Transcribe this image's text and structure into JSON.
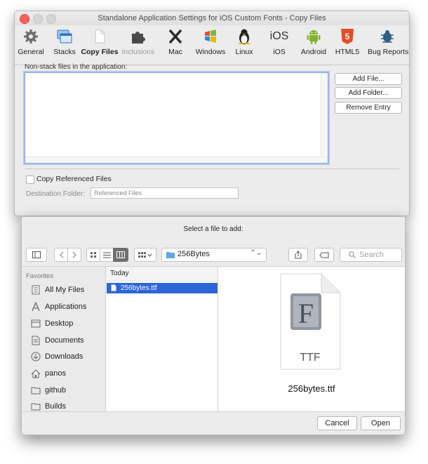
{
  "window": {
    "title": "Standalone Application Settings for iOS Custom Fonts - Copy Files"
  },
  "toolbar": {
    "items": [
      {
        "label": "General",
        "icon": "gear-icon"
      },
      {
        "label": "Stacks",
        "icon": "stacks-icon"
      },
      {
        "label": "Copy Files",
        "icon": "document-icon",
        "selected": true
      },
      {
        "label": "Inclusions",
        "icon": "puzzle-icon",
        "disabled": true
      },
      {
        "label": "Mac",
        "icon": "mac-x-icon"
      },
      {
        "label": "Windows",
        "icon": "windows-icon"
      },
      {
        "label": "Linux",
        "icon": "linux-icon"
      },
      {
        "label": "iOS",
        "icon": "ios-icon",
        "icon_text": "iOS"
      },
      {
        "label": "Android",
        "icon": "android-icon"
      },
      {
        "label": "HTML5",
        "icon": "html5-icon",
        "icon_text": "5"
      },
      {
        "label": "Bug Reports",
        "icon": "bug-icon"
      }
    ]
  },
  "settings": {
    "non_stack_label": "Non-stack files in the application:",
    "add_file": "Add File...",
    "add_folder": "Add Folder...",
    "remove_entry": "Remove Entry",
    "copy_referenced": "Copy Referenced Files",
    "destination_label": "Destination Folder:",
    "destination_value": "Referenced Files"
  },
  "dialog": {
    "title": "Select a file to add:",
    "path": "256Bytes",
    "search_placeholder": "Search",
    "sidebar_heading": "Favorites",
    "sidebar_items": [
      {
        "label": "All My Files",
        "icon": "all-files-icon"
      },
      {
        "label": "Applications",
        "icon": "applications-icon"
      },
      {
        "label": "Desktop",
        "icon": "desktop-icon"
      },
      {
        "label": "Documents",
        "icon": "documents-icon"
      },
      {
        "label": "Downloads",
        "icon": "downloads-icon"
      },
      {
        "label": "panos",
        "icon": "home-icon"
      },
      {
        "label": "github",
        "icon": "folder-icon"
      },
      {
        "label": "Builds",
        "icon": "folder-icon"
      }
    ],
    "column_heading": "Today",
    "selected_file": "256bytes.ttf",
    "preview_badge": "F",
    "preview_type": "TTF",
    "preview_name": "256bytes.ttf",
    "cancel": "Cancel",
    "open": "Open"
  },
  "colors": {
    "selection": "#2c66d6",
    "close_button": "#fc605c",
    "list_focus": "#aec6ee"
  }
}
